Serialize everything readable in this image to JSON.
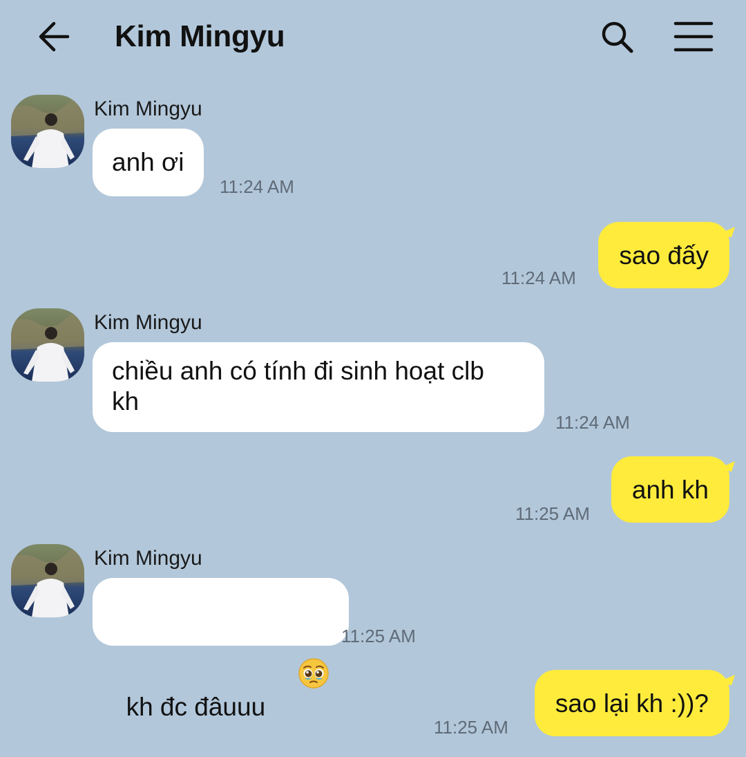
{
  "header": {
    "back_icon": "arrow-left-icon",
    "title": "Kim Mingyu",
    "search_icon": "search-icon",
    "menu_icon": "hamburger-menu-icon"
  },
  "colors": {
    "background": "#b2c7da",
    "incoming_bubble": "#ffffff",
    "outgoing_bubble": "#feeb3c",
    "timestamp": "#5f6b78"
  },
  "messages": [
    {
      "direction": "in",
      "sender": "Kim Mingyu",
      "text": "anh ơi",
      "time": "11:24 AM"
    },
    {
      "direction": "out",
      "text": "sao đấy",
      "time": "11:24 AM"
    },
    {
      "direction": "in",
      "sender": "Kim Mingyu",
      "text": "chiều anh có tính đi sinh hoạt clb\nkh",
      "time": "11:24 AM"
    },
    {
      "direction": "out",
      "text": "anh kh",
      "time": "11:25 AM"
    },
    {
      "direction": "in",
      "sender": "Kim Mingyu",
      "text": "kh đc đâuuu",
      "emoji": "pleading-face-emoji",
      "time": "11:25 AM"
    },
    {
      "direction": "out",
      "text": "sao lại kh :))?",
      "time": "11:25 AM"
    }
  ]
}
